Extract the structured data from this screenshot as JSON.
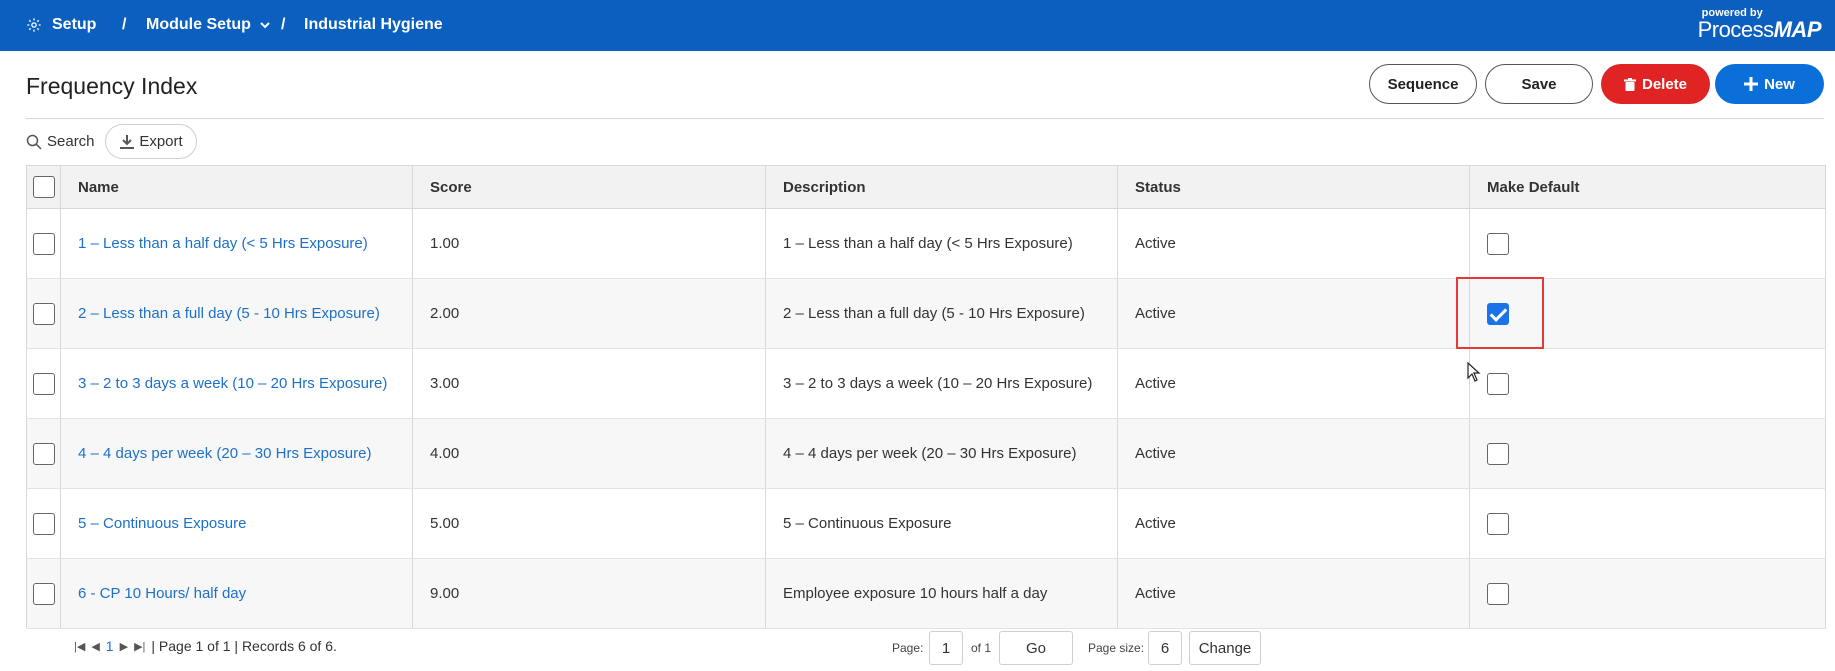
{
  "breadcrumb": {
    "setup": "Setup",
    "separator": "/",
    "module_setup": "Module Setup",
    "current": "Industrial Hygiene"
  },
  "brand": {
    "powered_by": "powered by",
    "name_prefix": "Process",
    "name_suffix": "MAP"
  },
  "page": {
    "title": "Frequency Index"
  },
  "actions": {
    "sequence": "Sequence",
    "save": "Save",
    "delete": "Delete",
    "new": "New"
  },
  "toolbar": {
    "search": "Search",
    "export": "Export"
  },
  "grid": {
    "columns": [
      "Name",
      "Score",
      "Description",
      "Status",
      "Make Default"
    ],
    "rows": [
      {
        "name": "1 – Less than a half day (< 5 Hrs Exposure)",
        "score": "1.00",
        "description": "1 – Less than a half day (< 5 Hrs Exposure)",
        "status": "Active",
        "make_default": false
      },
      {
        "name": "2 – Less than a full day (5 - 10 Hrs Exposure)",
        "score": "2.00",
        "description": "2 – Less than a full day (5 - 10 Hrs Exposure)",
        "status": "Active",
        "make_default": true
      },
      {
        "name": "3 – 2 to 3 days a week (10 – 20 Hrs Exposure)",
        "score": "3.00",
        "description": "3 – 2 to 3 days a week (10 – 20 Hrs Exposure)",
        "status": "Active",
        "make_default": false
      },
      {
        "name": "4 – 4 days per week (20 – 30 Hrs Exposure)",
        "score": "4.00",
        "description": "4 – 4 days per week (20 – 30 Hrs Exposure)",
        "status": "Active",
        "make_default": false
      },
      {
        "name": "5 – Continuous Exposure",
        "score": "5.00",
        "description": "5 – Continuous Exposure",
        "status": "Active",
        "make_default": false
      },
      {
        "name": "6 - CP 10 Hours/ half day",
        "score": "9.00",
        "description": "Employee exposure 10 hours half a day",
        "status": "Active",
        "make_default": false
      }
    ]
  },
  "pager": {
    "current_page_link": "1",
    "summary": "| Page 1 of 1 | Records 6 of 6.",
    "page_label": "Page:",
    "page_value": "1",
    "of_label": "of 1",
    "go": "Go",
    "page_size_label": "Page size:",
    "page_size_value": "6",
    "change": "Change"
  },
  "colors": {
    "topbar": "#0b5fbe",
    "link": "#1d70c8",
    "delete": "#e02424",
    "new": "#0b6fd9",
    "checked": "#1a73e8",
    "highlight": "#e53935"
  }
}
